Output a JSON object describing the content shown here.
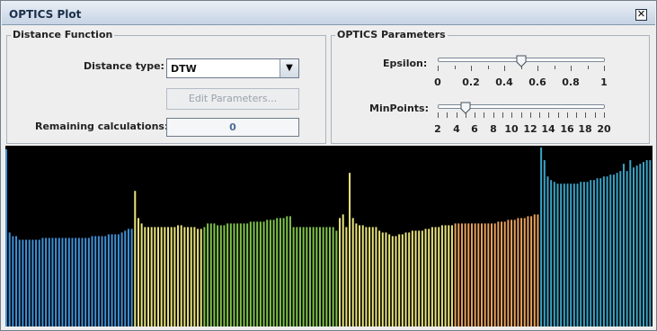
{
  "window": {
    "title": "OPTICS Plot",
    "close_glyph": "✕"
  },
  "distance_function": {
    "title": "Distance Function",
    "distance_type_label": "Distance type:",
    "distance_type_value": "DTW",
    "edit_parameters_label": "Edit Parameters...",
    "remaining_label": "Remaining calculations:",
    "remaining_value": "0"
  },
  "optics_parameters": {
    "title": "OPTICS Parameters",
    "epsilon": {
      "label": "Epsilon:",
      "value": 0.5,
      "min": 0,
      "max": 1,
      "tick_labels": [
        "0",
        "0.2",
        "0.4",
        "0.6",
        "0.8",
        "1"
      ]
    },
    "minpoints": {
      "label": "MinPoints:",
      "value": 5,
      "min": 2,
      "max": 20,
      "tick_labels": [
        "2",
        "4",
        "6",
        "8",
        "10",
        "12",
        "14",
        "16",
        "18",
        "20"
      ]
    }
  },
  "colors": {
    "cluster_blue": "#3f8fd6",
    "cluster_yellow": "#e8e27a",
    "cluster_green": "#7fc24a",
    "cluster_orange": "#e7a05a",
    "cluster_teal": "#3aa2c4"
  },
  "chart_data": {
    "type": "bar",
    "ylim": [
      0,
      1
    ],
    "series": [
      {
        "color_key": "cluster_blue",
        "values": [
          0.98,
          0.52,
          0.5,
          0.5,
          0.48,
          0.48,
          0.48,
          0.48,
          0.48,
          0.48,
          0.48,
          0.49,
          0.49,
          0.49,
          0.49,
          0.49,
          0.49,
          0.49,
          0.49,
          0.49,
          0.49,
          0.49,
          0.49,
          0.49,
          0.49,
          0.49,
          0.5,
          0.5,
          0.5,
          0.5,
          0.5,
          0.51,
          0.51,
          0.51,
          0.51,
          0.52,
          0.53,
          0.54,
          0.54
        ]
      },
      {
        "color_key": "cluster_yellow",
        "values": [
          0.75,
          0.6,
          0.57,
          0.55,
          0.55,
          0.55,
          0.55,
          0.55,
          0.55,
          0.55,
          0.55,
          0.55,
          0.55,
          0.56,
          0.56,
          0.55,
          0.55,
          0.55,
          0.55,
          0.54,
          0.54
        ]
      },
      {
        "color_key": "cluster_green",
        "values": [
          0.55,
          0.57,
          0.57,
          0.57,
          0.56,
          0.56,
          0.56,
          0.57,
          0.57,
          0.57,
          0.57,
          0.57,
          0.57,
          0.57,
          0.58,
          0.58,
          0.58,
          0.58,
          0.58,
          0.59,
          0.59,
          0.59,
          0.6,
          0.6,
          0.6,
          0.61,
          0.61,
          0.55,
          0.55,
          0.55,
          0.55,
          0.55,
          0.55,
          0.55,
          0.55,
          0.55,
          0.55,
          0.55,
          0.55,
          0.55,
          0.53
        ]
      },
      {
        "color_key": "cluster_yellow",
        "values": [
          0.6,
          0.62,
          0.55,
          0.85,
          0.6,
          0.57,
          0.56,
          0.56,
          0.55,
          0.55,
          0.55,
          0.55,
          0.53,
          0.52,
          0.52,
          0.51,
          0.5,
          0.5,
          0.51,
          0.51,
          0.52,
          0.52,
          0.53,
          0.53,
          0.53,
          0.53,
          0.54,
          0.54,
          0.55,
          0.55,
          0.55,
          0.56,
          0.56,
          0.56,
          0.56
        ]
      },
      {
        "color_key": "cluster_orange",
        "values": [
          0.57,
          0.57,
          0.57,
          0.57,
          0.57,
          0.57,
          0.57,
          0.57,
          0.57,
          0.57,
          0.57,
          0.57,
          0.57,
          0.58,
          0.58,
          0.58,
          0.59,
          0.59,
          0.59,
          0.6,
          0.6,
          0.6,
          0.61,
          0.61,
          0.62,
          0.62
        ]
      },
      {
        "color_key": "cluster_teal",
        "values": [
          0.99,
          0.92,
          0.83,
          0.81,
          0.8,
          0.79,
          0.79,
          0.79,
          0.79,
          0.79,
          0.79,
          0.79,
          0.8,
          0.8,
          0.8,
          0.81,
          0.81,
          0.82,
          0.82,
          0.83,
          0.83,
          0.84,
          0.84,
          0.85,
          0.86,
          0.9,
          0.86,
          0.92,
          0.88,
          0.89,
          0.9,
          0.91,
          0.92,
          0.92
        ]
      }
    ]
  }
}
